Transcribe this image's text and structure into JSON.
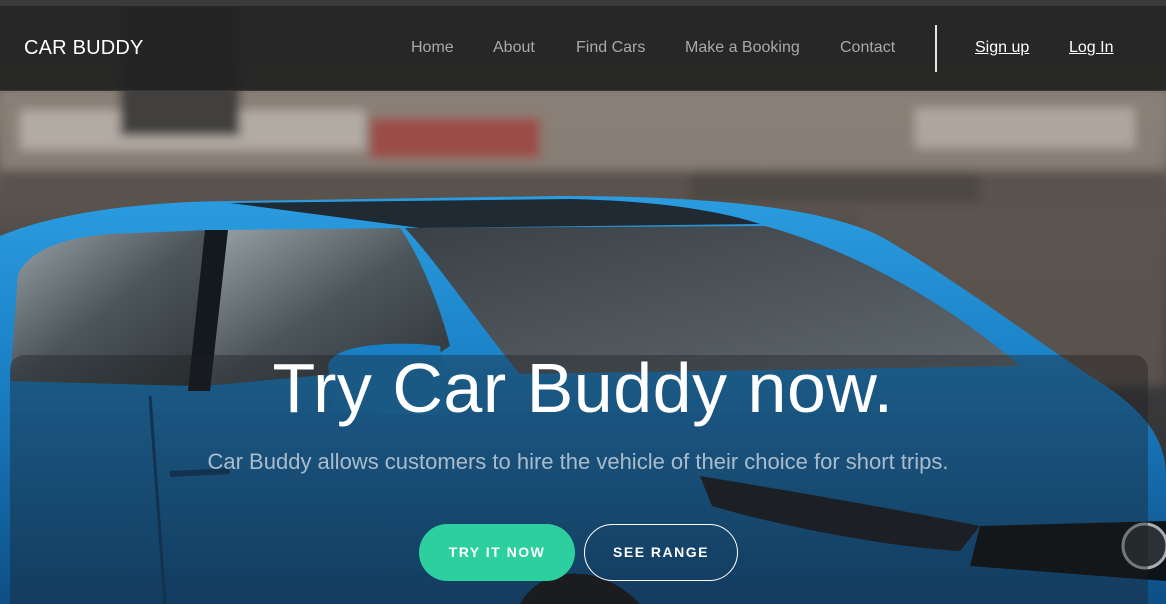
{
  "brand": {
    "name": "CAR BUDDY"
  },
  "nav": {
    "items": [
      {
        "label": "Home"
      },
      {
        "label": "About"
      },
      {
        "label": "Find Cars"
      },
      {
        "label": "Make a Booking"
      },
      {
        "label": "Contact"
      }
    ],
    "auth": {
      "signup_label": "Sign up",
      "login_label": "Log In"
    }
  },
  "hero": {
    "headline": "Try Car Buddy now.",
    "subline": "Car Buddy allows customers to hire the vehicle of their choice for short trips.",
    "primary_button": "TRY IT NOW",
    "secondary_button": "SEE RANGE",
    "background_image": "blurred-street-with-blue-hatchback-car"
  },
  "colors": {
    "navbar_bg": "#222222",
    "nav_link": "#a9a9a9",
    "accent": "#2ecf9e",
    "car_blue": "#1a7fc4",
    "text_white": "#ffffff"
  }
}
